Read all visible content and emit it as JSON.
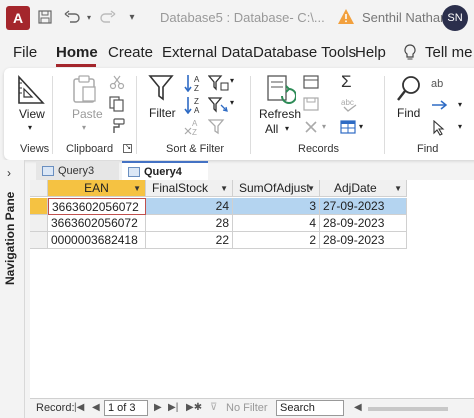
{
  "titlebar": {
    "app_logo": "A",
    "title": "Database5 : Database- C:\\...",
    "user_name": "Senthil Nathan",
    "user_initials": "SN"
  },
  "menu": {
    "tabs": [
      "File",
      "Home",
      "Create",
      "External Data",
      "Database Tools",
      "Help",
      "Tell me"
    ],
    "active": "Home"
  },
  "ribbon": {
    "view_label": "View",
    "paste_label": "Paste",
    "filter_label": "Filter",
    "refresh_label": "Refresh",
    "refresh_sub": "All",
    "find_label": "Find",
    "groups": {
      "views": "Views",
      "clipboard": "Clipboard",
      "sort_filter": "Sort & Filter",
      "records": "Records",
      "find": "Find"
    }
  },
  "nav_pane": {
    "label": "Navigation Pane"
  },
  "doc_tabs": [
    {
      "label": "Query3",
      "active": false
    },
    {
      "label": "Query4",
      "active": true
    }
  ],
  "table": {
    "columns": [
      "EAN",
      "FinalStock",
      "SumOfAdjust",
      "AdjDate"
    ],
    "rows": [
      {
        "EAN": "3663602056072",
        "FinalStock": "24",
        "SumOfAdjust": "3",
        "AdjDate": "27-09-2023"
      },
      {
        "EAN": "3663602056072",
        "FinalStock": "28",
        "SumOfAdjust": "4",
        "AdjDate": "28-09-2023"
      },
      {
        "EAN": "0000003682418",
        "FinalStock": "22",
        "SumOfAdjust": "2",
        "AdjDate": "28-09-2023"
      }
    ]
  },
  "record_nav": {
    "label": "Record:",
    "position": "1 of 3",
    "filter": "No Filter",
    "search_placeholder": "Search"
  },
  "colors": {
    "accent": "#a4262c",
    "header_selected": "#f5c242",
    "row_selected": "#b4d4f0"
  }
}
